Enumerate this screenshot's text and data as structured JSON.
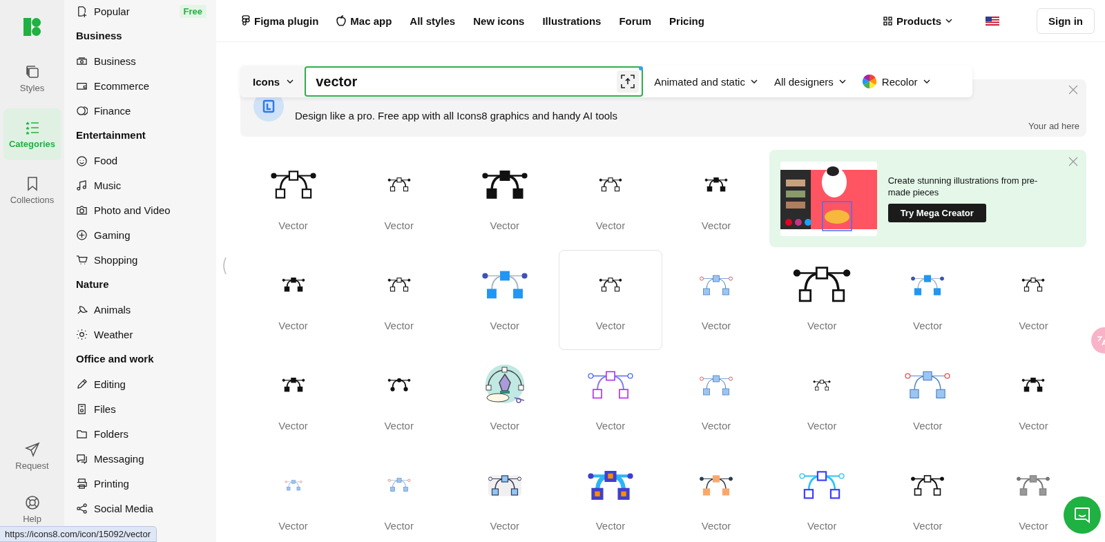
{
  "rail": {
    "items": [
      {
        "label": "Styles",
        "selected": false
      },
      {
        "label": "Categories",
        "selected": true
      },
      {
        "label": "Collections",
        "selected": false
      }
    ],
    "bottom": [
      {
        "label": "Request"
      },
      {
        "label": "Help"
      }
    ]
  },
  "sidebar": [
    {
      "kind": "item",
      "label": "Popular",
      "badge": "Free"
    },
    {
      "kind": "heading",
      "label": "Business"
    },
    {
      "kind": "item",
      "label": "Business"
    },
    {
      "kind": "item",
      "label": "Ecommerce"
    },
    {
      "kind": "item",
      "label": "Finance"
    },
    {
      "kind": "heading",
      "label": "Entertainment"
    },
    {
      "kind": "item",
      "label": "Food"
    },
    {
      "kind": "item",
      "label": "Music"
    },
    {
      "kind": "item",
      "label": "Photo and Video"
    },
    {
      "kind": "item",
      "label": "Gaming"
    },
    {
      "kind": "item",
      "label": "Shopping"
    },
    {
      "kind": "heading",
      "label": "Nature"
    },
    {
      "kind": "item",
      "label": "Animals"
    },
    {
      "kind": "item",
      "label": "Weather"
    },
    {
      "kind": "heading",
      "label": "Office and work"
    },
    {
      "kind": "item",
      "label": "Editing"
    },
    {
      "kind": "item",
      "label": "Files"
    },
    {
      "kind": "item",
      "label": "Folders"
    },
    {
      "kind": "item",
      "label": "Messaging"
    },
    {
      "kind": "item",
      "label": "Printing"
    },
    {
      "kind": "item",
      "label": "Social Media"
    }
  ],
  "nav": {
    "links": [
      "Figma plugin",
      "Mac app",
      "All styles",
      "New icons",
      "Illustrations",
      "Forum",
      "Pricing"
    ],
    "products": "Products",
    "sign_in": "Sign in"
  },
  "search": {
    "type": "Icons",
    "value": "vector",
    "filters": [
      "Animated and static",
      "All designers",
      "Recolor"
    ]
  },
  "ad": {
    "text": "Design like a pro. Free app with all Icons8 graphics and handy AI tools",
    "note": "Your ad here"
  },
  "promo": {
    "text": "Create stunning illustrations from pre-made pieces",
    "button": "Try Mega Creator"
  },
  "tiles": [
    {
      "label": "Vector",
      "selected": false
    },
    {
      "label": "Vector",
      "selected": false
    },
    {
      "label": "Vector",
      "selected": false
    },
    {
      "label": "Vector",
      "selected": false
    },
    {
      "label": "Vector",
      "selected": false
    },
    {
      "label": "Vector",
      "selected": false
    },
    {
      "label": "Vector",
      "selected": false
    },
    {
      "label": "Vector",
      "selected": false
    },
    {
      "label": "Vector",
      "selected": true
    },
    {
      "label": "Vector",
      "selected": false
    },
    {
      "label": "Vector",
      "selected": false
    },
    {
      "label": "Vector",
      "selected": false
    },
    {
      "label": "Vector",
      "selected": false
    },
    {
      "label": "Vector",
      "selected": false
    },
    {
      "label": "Vector",
      "selected": false
    },
    {
      "label": "Vector",
      "selected": false
    },
    {
      "label": "Vector",
      "selected": false
    },
    {
      "label": "Vector",
      "selected": false
    },
    {
      "label": "Vector",
      "selected": false
    },
    {
      "label": "Vector",
      "selected": false
    },
    {
      "label": "Vector",
      "selected": false
    },
    {
      "label": "Vector",
      "selected": false
    },
    {
      "label": "Vector",
      "selected": false
    },
    {
      "label": "Vector",
      "selected": false
    },
    {
      "label": "Vector",
      "selected": false
    },
    {
      "label": "Vector",
      "selected": false
    },
    {
      "label": "Vector",
      "selected": false
    },
    {
      "label": "Vector",
      "selected": false
    },
    {
      "label": "Vector",
      "selected": false
    }
  ],
  "status_url": "https://icons8.com/icon/15092/vector"
}
